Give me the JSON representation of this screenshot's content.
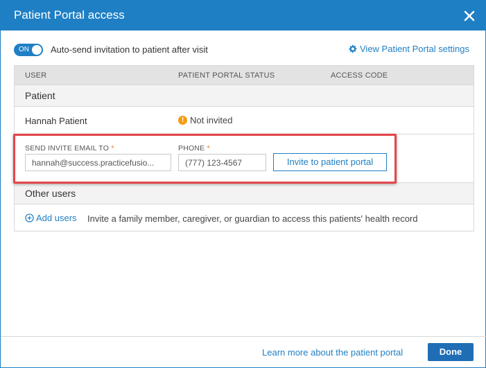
{
  "dialog": {
    "title": "Patient Portal access"
  },
  "auto_send": {
    "toggle_label": "ON",
    "text": "Auto-send invitation to patient after visit"
  },
  "settings_link": {
    "label": "View Patient Portal settings",
    "icon": "gear-icon"
  },
  "table": {
    "columns": [
      "USER",
      "PATIENT PORTAL STATUS",
      "ACCESS CODE"
    ],
    "patient_section": "Patient",
    "patient": {
      "name": "Hannah Patient",
      "status": "Not invited",
      "status_icon": "warning-icon"
    },
    "invite_form": {
      "email_label": "SEND INVITE EMAIL TO",
      "email_value": "hannah@success.practicefusio...",
      "phone_label": "PHONE",
      "phone_value": "(777) 123-4567",
      "required_mark": "*",
      "invite_button": "Invite to patient portal"
    },
    "other_section": "Other users",
    "add_users": {
      "label": "Add users",
      "description": "Invite a family member, caregiver, or guardian to access this patients' health record"
    }
  },
  "footer": {
    "learn_more": "Learn more about the patient portal",
    "done": "Done"
  },
  "colors": {
    "primary": "#1f7fc4",
    "highlight": "#e4454a",
    "warning": "#f39c12",
    "required": "#e8732a"
  }
}
